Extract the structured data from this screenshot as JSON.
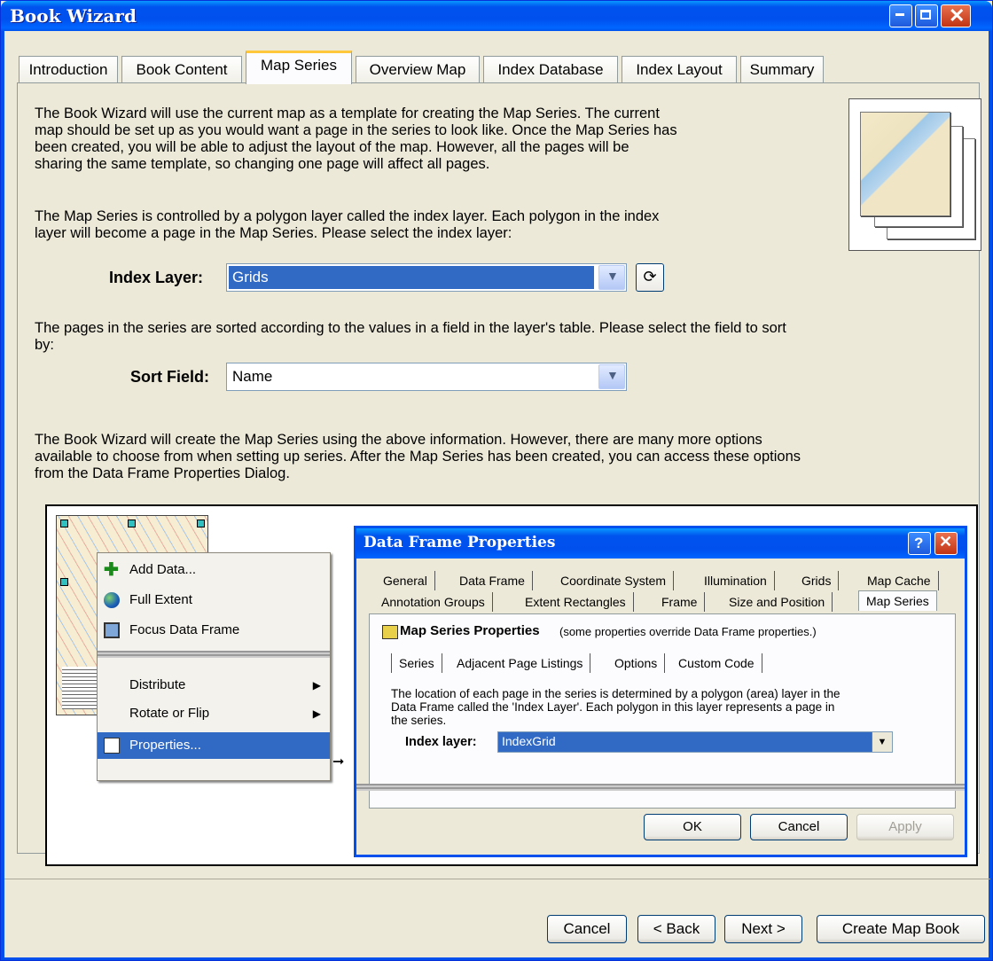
{
  "window": {
    "title": "Book Wizard"
  },
  "tabs": [
    {
      "label": "Introduction"
    },
    {
      "label": "Book Content"
    },
    {
      "label": "Map Series"
    },
    {
      "label": "Overview Map"
    },
    {
      "label": "Index Database"
    },
    {
      "label": "Index Layout"
    },
    {
      "label": "Summary"
    }
  ],
  "main": {
    "intro_lines": [
      "The Book Wizard will use the current map as a template for creating the Map Series.  The current",
      "map should be set up as you would want a page in the series to look like.  Once the Map Series has",
      "been created, you will be able to adjust the layout of the map.  However, all the pages will be",
      "sharing the same template, so changing one page will affect all pages."
    ],
    "index_lines": [
      "The Map Series is controlled by a polygon layer called the index layer.  Each polygon in the index",
      "layer will become a page in the Map Series.  Please select the index layer:"
    ],
    "index_layer_label": "Index Layer:",
    "index_layer_value": "Grids",
    "sort_lines": [
      "The pages in the series are sorted according to the values in a field in the layer's table.  Please select the field to sort",
      "by:"
    ],
    "sort_field_label": "Sort Field:",
    "sort_field_value": "Name",
    "options_lines": [
      "The Book Wizard will create the Map Series using the above information.  However, there are many more options",
      "available to choose from when setting up series.  After the Map Series has been created, you can access these options",
      "from the Data Frame Properties Dialog."
    ]
  },
  "illustration": {
    "context_menu": [
      {
        "label": "Add Data...",
        "icon": "add-data-icon"
      },
      {
        "label": "Full Extent",
        "icon": "globe-icon"
      },
      {
        "label": "Focus Data Frame",
        "icon": "focus-frame-icon"
      },
      {
        "label": "Distribute",
        "submenu": true
      },
      {
        "label": "Rotate or Flip",
        "submenu": true
      },
      {
        "label": "Properties...",
        "icon": "properties-icon",
        "highlighted": true
      }
    ],
    "dialog": {
      "title": "Data Frame Properties",
      "tabs_row1": [
        "General",
        "Data Frame",
        "Coordinate System",
        "Illumination",
        "Grids",
        "Map Cache"
      ],
      "tabs_row2": [
        "Annotation Groups",
        "Extent Rectangles",
        "Frame",
        "Size and Position",
        "Map Series"
      ],
      "section_title": "Map Series Properties",
      "section_note": "(some properties override Data Frame properties.)",
      "subtabs": [
        "Series",
        "Adjacent Page Listings",
        "Options",
        "Custom Code"
      ],
      "desc_lines": [
        "The location of each page in the series is determined by a polygon (area) layer in the",
        "Data Frame called the 'Index Layer'.  Each polygon in this layer represents a page in",
        "the series."
      ],
      "index_layer_label": "Index layer:",
      "index_layer_value": "IndexGrid",
      "ok": "OK",
      "cancel": "Cancel",
      "apply": "Apply"
    }
  },
  "footer": {
    "cancel": "Cancel",
    "back": "< Back",
    "next": "Next >",
    "create": "Create Map Book"
  },
  "colors": {
    "title_bar": "#0050EE",
    "selection": "#316AC5",
    "face": "#ECE9D8"
  }
}
